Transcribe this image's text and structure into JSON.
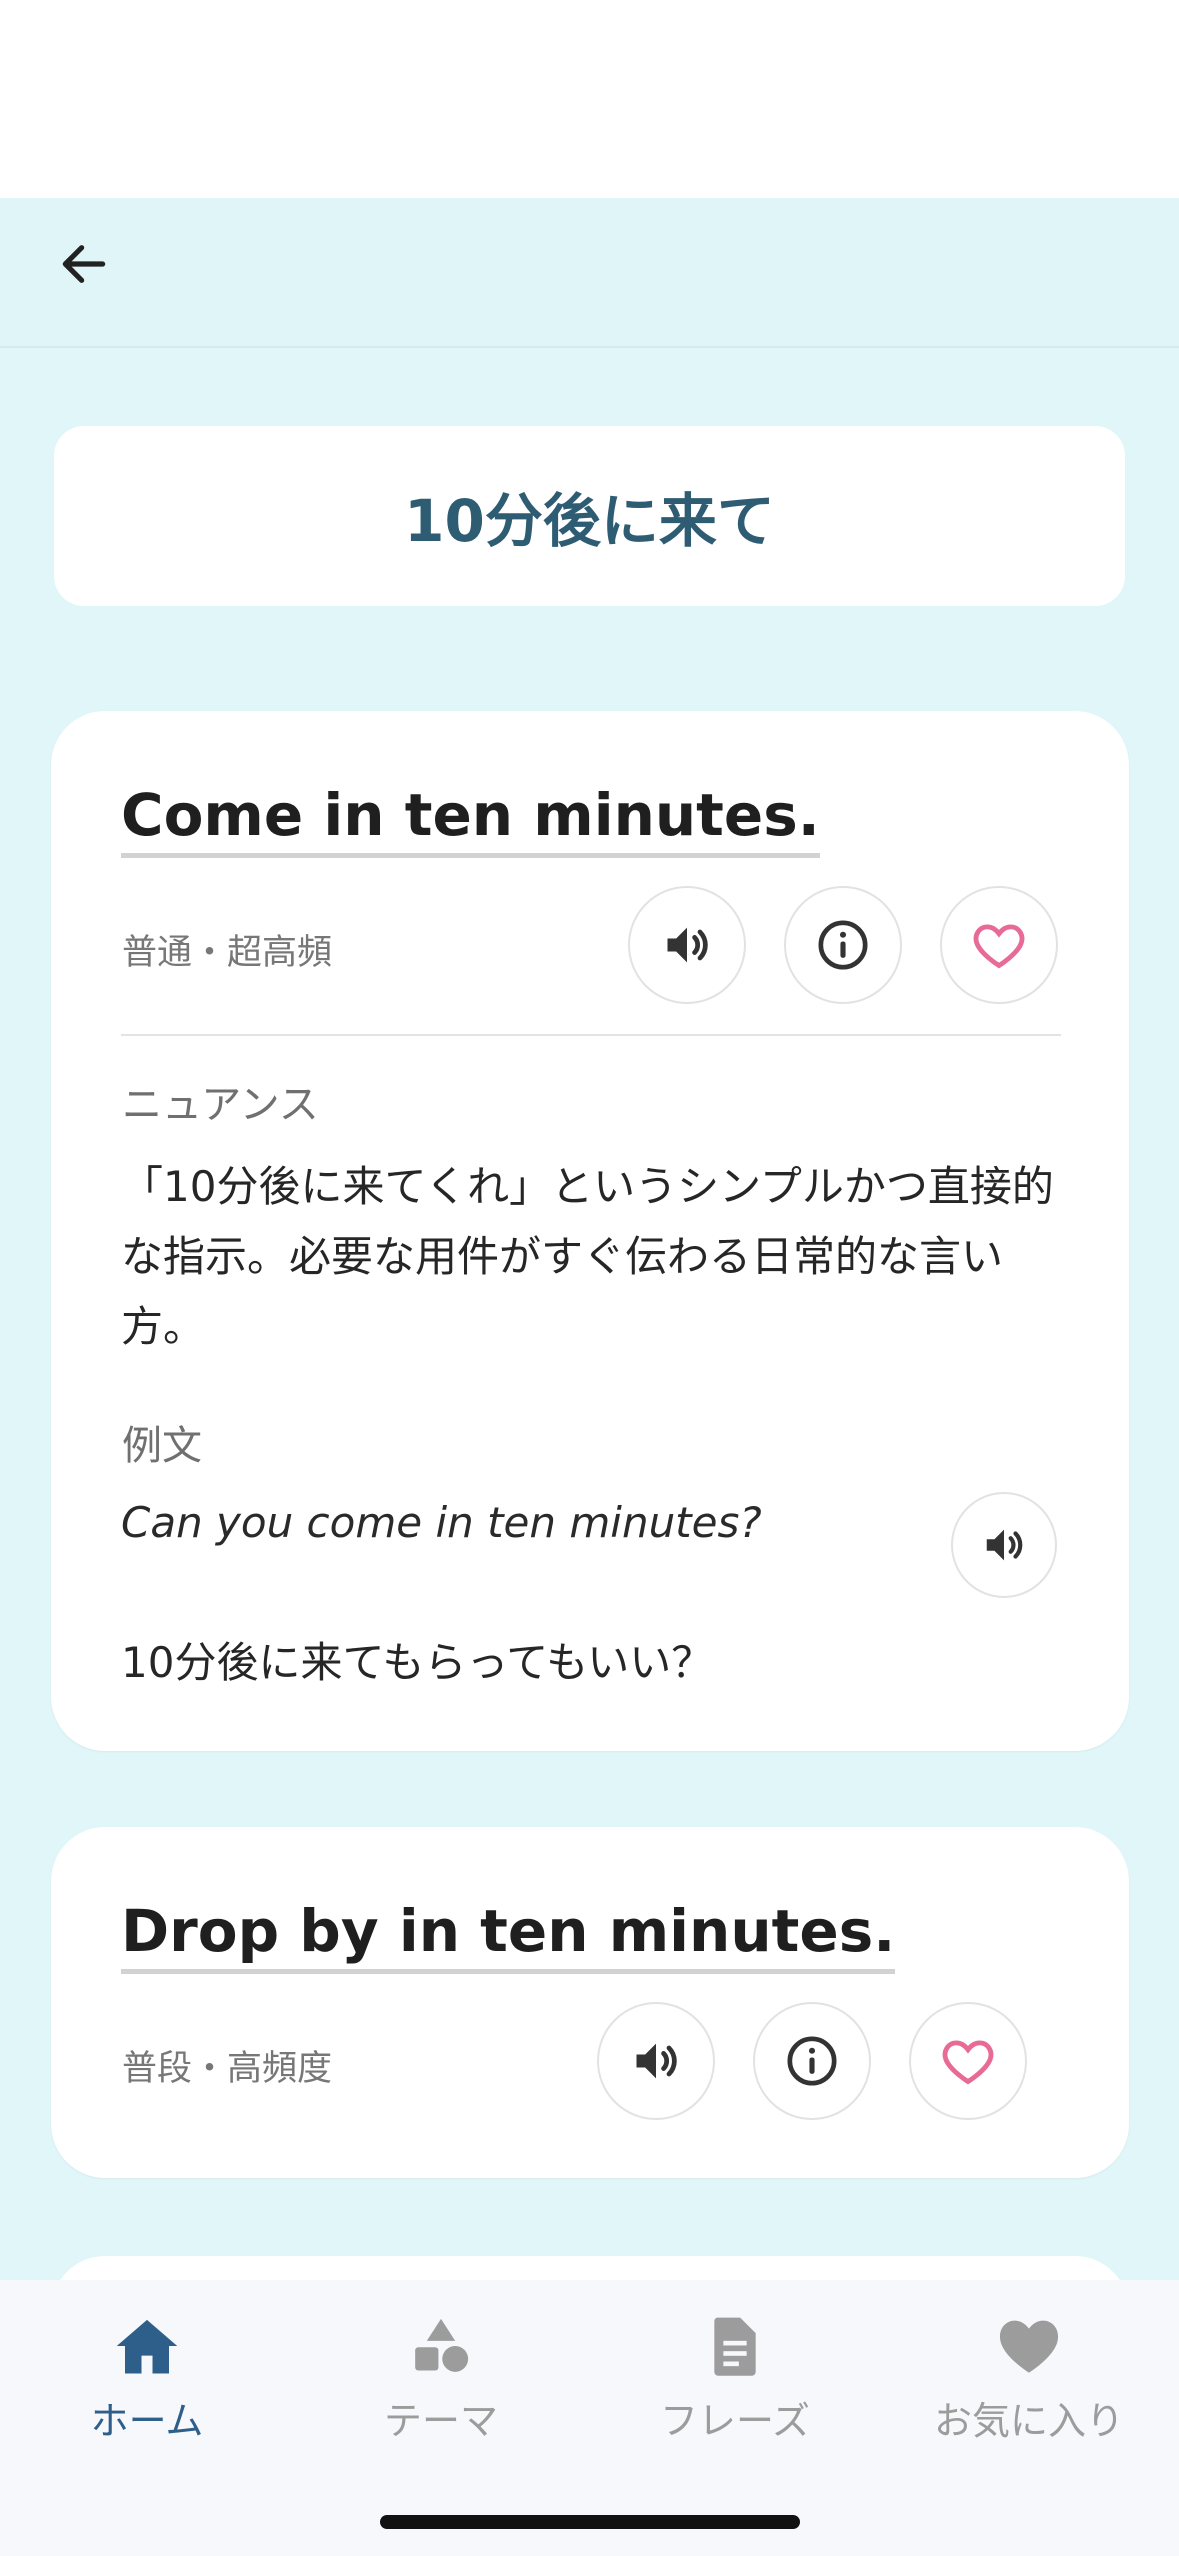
{
  "title": "10分後に来て",
  "cards": [
    {
      "phrase": "Come in ten minutes.",
      "meta": "普通・超高頻",
      "nuance_label": "ニュアンス",
      "nuance": "「10分後に来てくれ」というシンプルかつ直接的な指示。必要な用件がすぐ伝わる日常的な言い方。",
      "example_label": "例文",
      "example_en": "Can you come in ten minutes?",
      "example_ja": "10分後に来てもらってもいい？"
    },
    {
      "phrase": "Drop by in ten minutes.",
      "meta": "普段・高頻度"
    }
  ],
  "tabs": [
    {
      "label": "ホーム",
      "icon": "home-icon",
      "active": true
    },
    {
      "label": "テーマ",
      "icon": "shapes-icon",
      "active": false
    },
    {
      "label": "フレーズ",
      "icon": "document-icon",
      "active": false
    },
    {
      "label": "お気に入り",
      "icon": "heart-icon",
      "active": false
    }
  ],
  "colors": {
    "background": "#e0f6f8",
    "title_text": "#2e5c73",
    "heart": "#e86a96",
    "tab_active": "#2e5f8a",
    "tab_inactive": "#9c9c9c"
  }
}
